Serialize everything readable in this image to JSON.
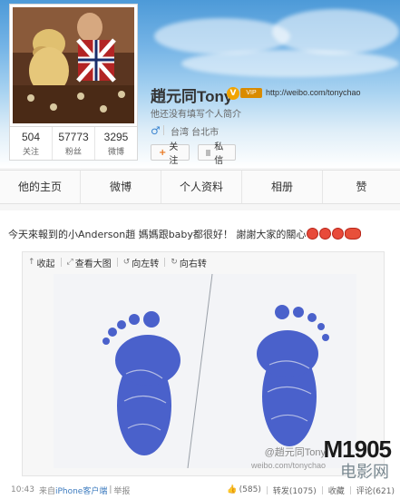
{
  "profile": {
    "name": "趙元同Tony",
    "url": "http://weibo.com/tonychao",
    "bio": "他还没有填写个人简介",
    "gender_icon": "male-icon",
    "location": "台湾 台北市",
    "stats": [
      {
        "value": "504",
        "label": "关注"
      },
      {
        "value": "57773",
        "label": "粉丝"
      },
      {
        "value": "3295",
        "label": "微博"
      }
    ],
    "follow_label": "关注",
    "message_label": "私信"
  },
  "nav": {
    "items": [
      "他的主页",
      "微博",
      "个人资料",
      "相册",
      "赞"
    ]
  },
  "post": {
    "text": "今天來報到的小Anderson趙 媽媽跟baby都很好！ 謝謝大家的關心",
    "tools": [
      "收起",
      "查看大图",
      "向左转",
      "向右转"
    ],
    "time": "10:43",
    "source_prefix": "来自",
    "source": "iPhone客户端",
    "report": "举报",
    "likes": "(585)",
    "repost": "转发(1075)",
    "favorite": "收藏",
    "comment": "评论(621)",
    "wm_user": "@趙元同Tony",
    "wm_site": "weibo.com/tonychao"
  },
  "watermark": {
    "logo": "M1905",
    "sub": "电影网"
  },
  "colors": {
    "accent": "#3d86d0",
    "follow": "#e8741a",
    "verified": "#f2a400"
  }
}
